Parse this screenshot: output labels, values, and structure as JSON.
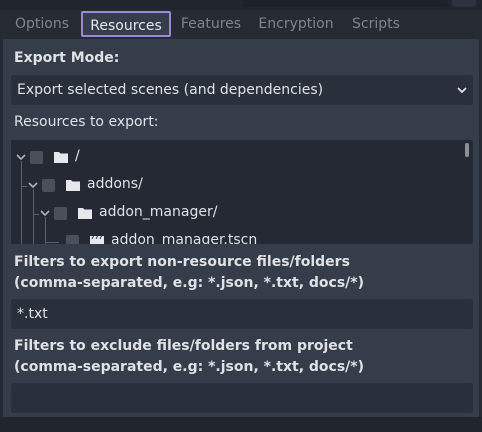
{
  "tabs": [
    {
      "label": "Options",
      "active": false
    },
    {
      "label": "Resources",
      "active": true
    },
    {
      "label": "Features",
      "active": false
    },
    {
      "label": "Encryption",
      "active": false
    },
    {
      "label": "Scripts",
      "active": false
    }
  ],
  "export_mode": {
    "label": "Export Mode:",
    "selected": "Export selected scenes (and dependencies)",
    "icon": "chevron-down-icon"
  },
  "resources": {
    "label": "Resources to export:",
    "tree": [
      {
        "name": "/",
        "type": "folder",
        "checked": false,
        "expanded": true
      },
      {
        "name": "addons/",
        "type": "folder",
        "checked": false,
        "expanded": true
      },
      {
        "name": "addon_manager/",
        "type": "folder",
        "checked": false,
        "expanded": true
      },
      {
        "name": "addon_manager.tscn",
        "type": "scene",
        "checked": false
      }
    ]
  },
  "include_filters": {
    "label_line1": "Filters to export non-resource files/folders",
    "label_line2": "(comma-separated, e.g: *.json, *.txt, docs/*)",
    "value": "*.txt"
  },
  "exclude_filters": {
    "label_line1": "Filters to exclude files/folders from project",
    "label_line2": "(comma-separated, e.g: *.json, *.txt, docs/*)",
    "value": ""
  },
  "colors": {
    "accent": "#9b87d6",
    "panel": "#363d4a",
    "field": "#2a303b",
    "background": "#252a33"
  }
}
